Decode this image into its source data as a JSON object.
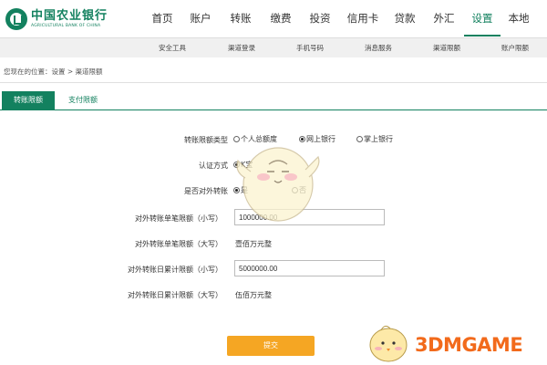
{
  "header": {
    "bank_name_cn": "中国农业银行",
    "bank_name_en": "AGRICULTURAL BANK OF CHINA",
    "nav": [
      "首页",
      "账户",
      "转账",
      "缴费",
      "投资",
      "信用卡",
      "贷款",
      "外汇",
      "设置",
      "本地"
    ],
    "active_nav_index": 8
  },
  "subnav": [
    "安全工具",
    "渠道登录",
    "手机号码",
    "消息服务",
    "渠道限额",
    "账户限额"
  ],
  "breadcrumb": "您现在的位置：设置 > 渠道限额",
  "tabs": {
    "active": "转账限额",
    "inactive": "支付限额"
  },
  "form": {
    "type_label": "转账限额类型",
    "type_options": [
      "个人总额度",
      "网上银行",
      "掌上银行"
    ],
    "type_selected": 1,
    "auth_label": "认证方式",
    "auth_option": "K宝",
    "external_label": "是否对外转账",
    "external_options": [
      "是",
      "否"
    ],
    "external_selected": 0,
    "single_small_label": "对外转账单笔限额（小写）",
    "single_small_value": "1000000.00",
    "single_big_label": "对外转账单笔限额（大写）",
    "single_big_value": "壹佰万元整",
    "daily_small_label": "对外转账日累计限额（小写）",
    "daily_small_value": "5000000.00",
    "daily_big_label": "对外转账日累计限额（大写）",
    "daily_big_value": "伍佰万元整",
    "submit_label": "提交"
  },
  "watermark": "3DMGAME",
  "colors": {
    "brand_green": "#13815f",
    "submit_orange": "#f5a623",
    "watermark_orange": "#f26a1b"
  }
}
